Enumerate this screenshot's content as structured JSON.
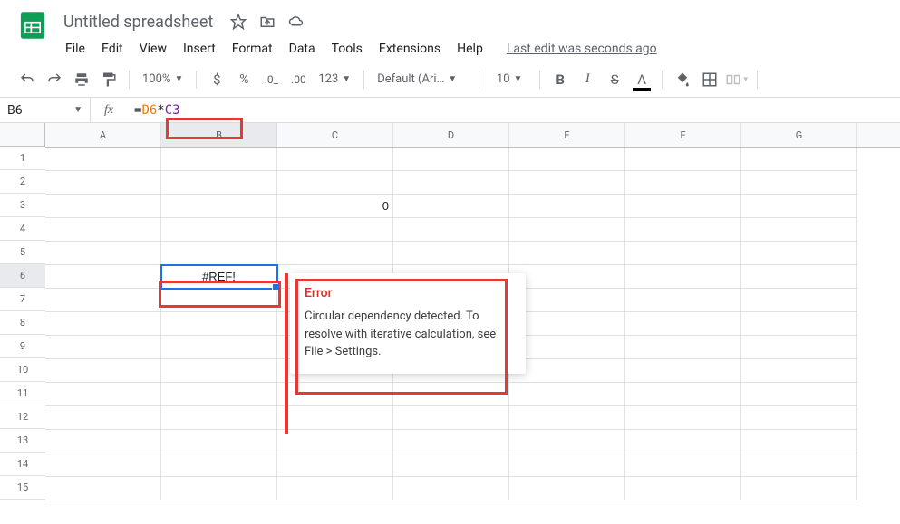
{
  "doc": {
    "title": "Untitled spreadsheet"
  },
  "menu": {
    "file": "File",
    "edit": "Edit",
    "view": "View",
    "insert": "Insert",
    "format": "Format",
    "data": "Data",
    "tools": "Tools",
    "extensions": "Extensions",
    "help": "Help",
    "last_edit": "Last edit was seconds ago"
  },
  "toolbar": {
    "zoom": "100%",
    "font": "Default (Ari…",
    "font_size": "10"
  },
  "formula_bar": {
    "cell_ref": "B6",
    "formula_eq": "=",
    "formula_ref1": "D6",
    "formula_op": "*",
    "formula_ref2": "C3"
  },
  "columns": [
    "A",
    "B",
    "C",
    "D",
    "E",
    "F",
    "G"
  ],
  "rows": [
    "1",
    "2",
    "3",
    "4",
    "5",
    "6",
    "7",
    "8",
    "9",
    "10",
    "11",
    "12",
    "13",
    "14",
    "15"
  ],
  "cells": {
    "C3": "0",
    "B6": "#REF!"
  },
  "tooltip": {
    "title": "Error",
    "body": "Circular dependency detected. To resolve with iterative calculation, see File > Settings."
  }
}
